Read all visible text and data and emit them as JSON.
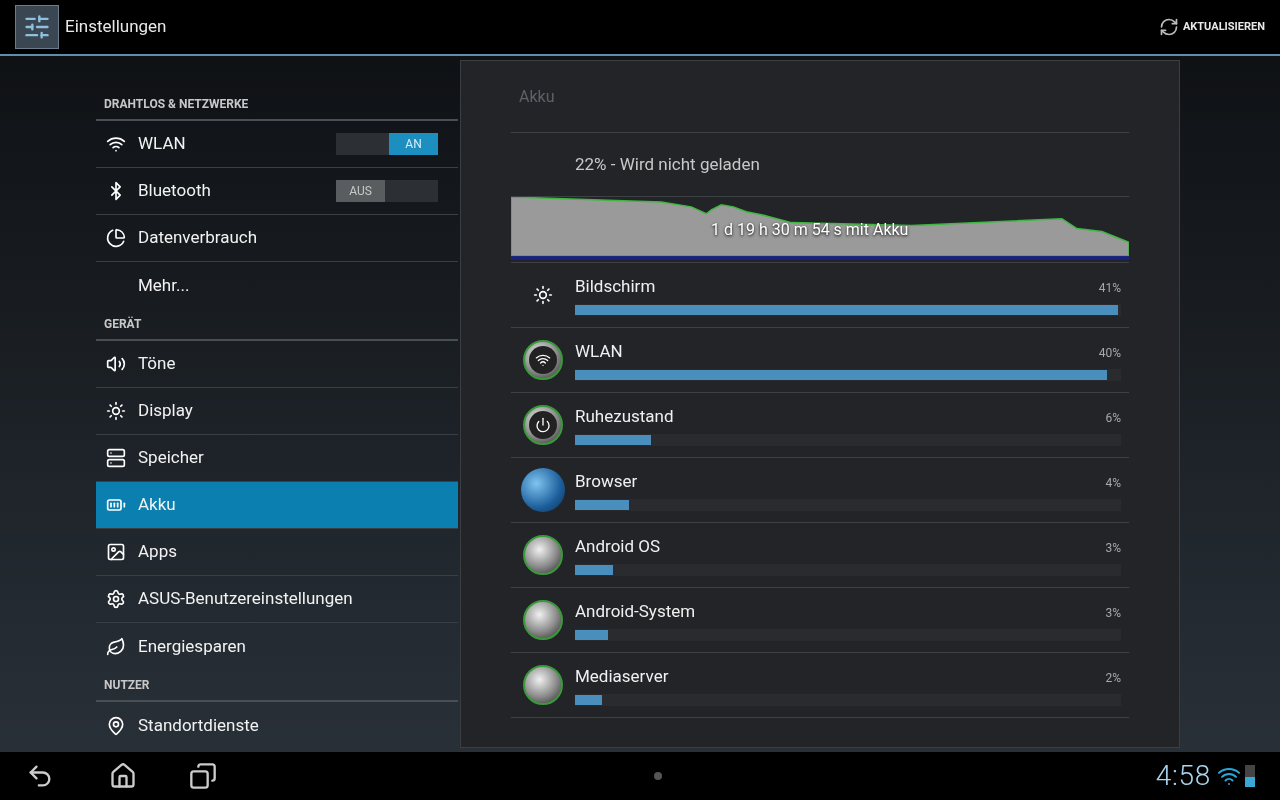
{
  "action_bar": {
    "title": "Einstellungen",
    "action": "AKTUALISIEREN"
  },
  "sidebar": {
    "sections": [
      {
        "title": "DRAHTLOS & NETZWERKE",
        "items": [
          {
            "label": "WLAN",
            "selected": false,
            "toggle": {
              "label": "AN",
              "on": true
            }
          },
          {
            "label": "Bluetooth",
            "selected": false,
            "toggle": {
              "label": "AUS",
              "on": false
            }
          },
          {
            "label": "Datenverbrauch",
            "selected": false
          },
          {
            "label": "Mehr...",
            "selected": false
          }
        ]
      },
      {
        "title": "GERÄT",
        "items": [
          {
            "label": "Töne",
            "selected": false
          },
          {
            "label": "Display",
            "selected": false
          },
          {
            "label": "Speicher",
            "selected": false
          },
          {
            "label": "Akku",
            "selected": true
          },
          {
            "label": "Apps",
            "selected": false
          },
          {
            "label": "ASUS-Benutzereinstellungen",
            "selected": false
          },
          {
            "label": "Energiesparen",
            "selected": false
          }
        ]
      },
      {
        "title": "NUTZER",
        "items": [
          {
            "label": "Standortdienste",
            "selected": false
          }
        ]
      }
    ]
  },
  "detail": {
    "title": "Akku",
    "status": "22% - Wird nicht geladen",
    "graph_label": "1 d 19 h 30 m 54 s mit Akku",
    "usage": [
      {
        "name": "Bildschirm",
        "percent": "41%",
        "level": 1.0
      },
      {
        "name": "WLAN",
        "percent": "40%",
        "level": 0.98
      },
      {
        "name": "Ruhezustand",
        "percent": "6%",
        "level": 0.14
      },
      {
        "name": "Browser",
        "percent": "4%",
        "level": 0.1
      },
      {
        "name": "Android OS",
        "percent": "3%",
        "level": 0.07
      },
      {
        "name": "Android-System",
        "percent": "3%",
        "level": 0.06
      },
      {
        "name": "Mediaserver",
        "percent": "2%",
        "level": 0.05
      }
    ]
  },
  "system_bar": {
    "time": "4:58"
  }
}
